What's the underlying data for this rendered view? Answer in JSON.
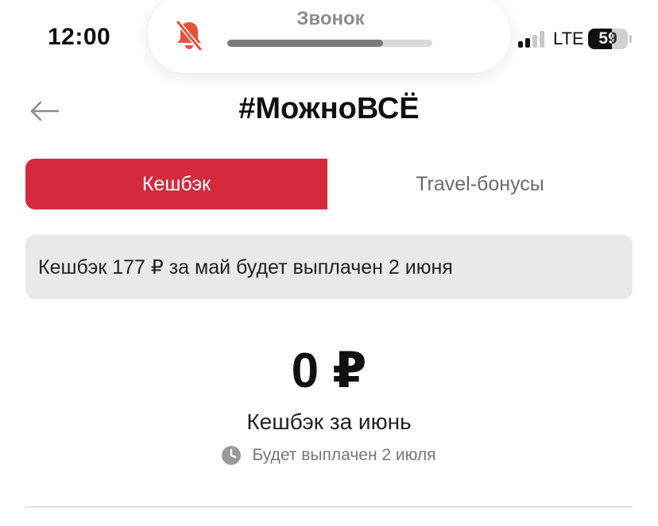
{
  "status_bar": {
    "time": "12:00",
    "network": "LTE",
    "battery_percent": 59,
    "battery_label": "59",
    "signal_bars_active": 2,
    "signal_bars_total": 4
  },
  "dynamic_island": {
    "title": "Звонок",
    "icon": "bell-slash-icon",
    "progress": 0.76
  },
  "header": {
    "back_icon": "arrow-left-icon",
    "title": "#МожноВСЁ"
  },
  "tabs": [
    {
      "label": "Кешбэк",
      "active": true
    },
    {
      "label": "Travel-бонусы",
      "active": false
    }
  ],
  "notice": {
    "text": "Кешбэк 177 ₽ за май будет выплачен 2 июня"
  },
  "cashback": {
    "amount": "0 ₽",
    "label": "Кешбэк за июнь",
    "payout_icon": "clock-icon",
    "payout_text": "Будет выплачен 2 июля"
  },
  "colors": {
    "accent": "#d42a3c",
    "notice_bg": "#e9e9ec",
    "muted_text": "#777777"
  }
}
